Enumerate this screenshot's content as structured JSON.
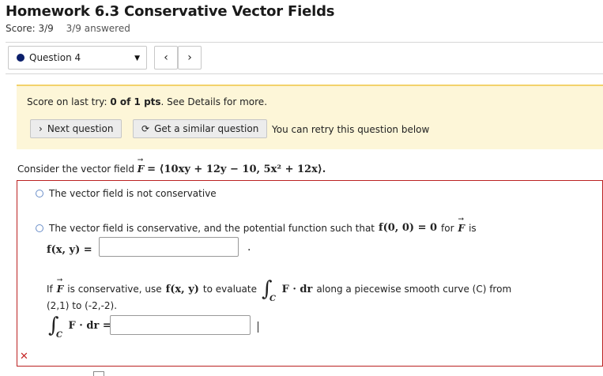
{
  "header": {
    "title": "Homework 6.3 Conservative Vector Fields",
    "score": "Score: 3/9",
    "answered": "3/9 answered"
  },
  "nav": {
    "question_label": "Question 4",
    "prev": "‹",
    "next": "›"
  },
  "banner": {
    "prefix": "Score on last try: ",
    "score": "0 of 1 pts",
    "suffix": ". See Details for more.",
    "next_question": "Next question",
    "similar_question": "Get a similar question",
    "retry_text": "You can retry this question below"
  },
  "question": {
    "prompt_prefix": "Consider the vector field",
    "field": "F",
    "field_expr": "= ⟨10xy + 12y − 10, 5x² + 12x⟩.",
    "option1": "The vector field is not conservative",
    "option2_prefix": "The vector field is conservative, and the potential function such that",
    "option2_f00": "f(0, 0) = 0",
    "option2_for": "for",
    "option2_is": "is",
    "fxy_label": "f(x, y) =",
    "fxy_value": "",
    "eval_prefix": "If",
    "eval_mid": "is conservative, use",
    "eval_fxy": "f(x, y)",
    "eval_to": "to evaluate",
    "eval_along": "along a piecewise smooth curve (C) from",
    "endpoints": "(2,1) to (-2,-2).",
    "integrand": "F · dr =",
    "integral_value": "",
    "curve_sub": "C"
  },
  "colors": {
    "banner_bg": "#fdf6d8",
    "error_border": "#bb2222",
    "dot": "#0b1f6b"
  }
}
